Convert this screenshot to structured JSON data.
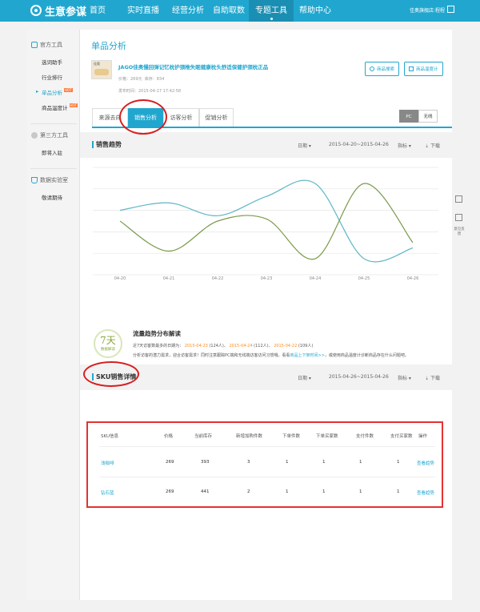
{
  "topbar": {
    "brand": "生意参谋",
    "nav": [
      "首页",
      "实时直播",
      "经营分析",
      "自助取数",
      "专题工具",
      "帮助中心"
    ],
    "active_nav": "专题工具",
    "user": "佳奥旗舰店:程程",
    "accent": "#21a7cf"
  },
  "sidebar": {
    "group1": "官方工具",
    "group1_items": [
      "选词助手",
      "行业排行",
      "单品分析",
      "商品温度计"
    ],
    "active_item": "单品分析",
    "hot_badge": "HOT",
    "group2": "第三方工具",
    "group2_items": [
      "即将入驻"
    ],
    "group3": "数据实验室",
    "group3_items": [
      "敬请期待"
    ]
  },
  "main": {
    "title": "单品分析",
    "product": {
      "name": "JAGO佳奥慢回弹记忆枕护颈椎失眠健康枕头舒适保健护颈枕正品",
      "price": "价格：269元",
      "stock": "库存：834",
      "published": "发布时间：2015-04-17 17:42:58",
      "img_label": "佳奥"
    },
    "btn_search": "商品搜索",
    "btn_thermo": "商品温度计",
    "tabs": [
      "来源去向",
      "销售分析",
      "访客分析",
      "促销分析"
    ],
    "active_tab": "销售分析",
    "device": [
      "PC",
      "无线"
    ]
  },
  "sales_trend": {
    "title": "销售趋势",
    "date_label": "日期",
    "range": "2015-04-20~2015-04-26",
    "metric": "指标",
    "download": "下载"
  },
  "chart_data": {
    "type": "line",
    "categories": [
      "04-20",
      "04-21",
      "04-22",
      "04-23",
      "04-24",
      "04-25",
      "04-26"
    ],
    "series": [
      {
        "color": "#5fb7c4",
        "values": [
          0.6,
          0.67,
          0.55,
          0.73,
          0.85,
          0.15,
          0.25
        ]
      },
      {
        "color": "#7a9a4a",
        "values": [
          0.5,
          0.22,
          0.5,
          0.52,
          0.15,
          0.85,
          0.3
        ]
      }
    ],
    "grid": true
  },
  "interpretation": {
    "badge_num": "7天",
    "badge_label": "数据解读",
    "title": "流量趋势分布解读",
    "line1_prefix": "近7天访客数最多的日期为：",
    "d1": "2015-04-23",
    "d1v": "(124人)、",
    "d2": "2015-04-24",
    "d2v": "(112人)、",
    "d3": "2015-04-22",
    "d3v": "(109人)",
    "line2_a": "分析访客的潜力需求，迎合访客需求！同时注意跟踪PC端和无线端访客访问习惯哦。看看",
    "line2_link": "商品上下架时间>>",
    "line2_b": "，或使用商品温度计诊断商品存在什么问题吧。"
  },
  "sku": {
    "title": "SKU销售详情",
    "date_label": "日期",
    "range": "2015-04-26~2015-04-26",
    "metric": "指标",
    "download": "下载",
    "headers": [
      "SKU信息",
      "价格",
      "当前库存",
      "新增加购件数",
      "下单件数",
      "下单买家数",
      "支付件数",
      "支付买家数",
      "操作"
    ],
    "rows": [
      [
        "浅咖啡",
        "269",
        "393",
        "3",
        "1",
        "1",
        "1",
        "1",
        "查看趋势"
      ],
      [
        "钻石蓝",
        "269",
        "441",
        "2",
        "1",
        "1",
        "1",
        "1",
        "查看趋势"
      ]
    ]
  },
  "float_tools": {
    "feedback": "意见反馈"
  }
}
